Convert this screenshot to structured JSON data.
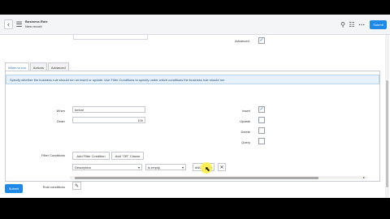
{
  "header": {
    "back_icon": "chevron-left-icon",
    "menu_icon": "hamburger-icon",
    "title": "Business Rule",
    "subtitle": "New record",
    "icons": [
      "paperclip-icon",
      "sliders-icon",
      "more-icon"
    ],
    "submit_label": "Submit"
  },
  "top": {
    "advanced_label": "Advanced",
    "advanced_checked": true
  },
  "tabs": [
    {
      "label": "When to run",
      "active": true
    },
    {
      "label": "Actions",
      "active": false
    },
    {
      "label": "Advanced",
      "active": false
    }
  ],
  "info_text": "Specify whether the business rule should run on insert or update. Use Filter Conditions to specify under which conditions the business rule should run",
  "form": {
    "when_label": "When",
    "when_value": "before",
    "order_label": "Order",
    "order_value": "100",
    "insert_label": "Insert",
    "insert_checked": true,
    "update_label": "Update",
    "delete_label": "Delete",
    "query_label": "Query"
  },
  "conditions": {
    "label": "Filter Conditions",
    "add_filter_label": "Add Filter Condition",
    "add_or_label": "Add \"OR\" Clause",
    "field_value": "Description",
    "operator_value": "is empty",
    "and_label": "AND",
    "or_label": "OR"
  },
  "role_conditions": {
    "label": "Role conditions"
  },
  "footer": {
    "submit_label": "Submit"
  }
}
